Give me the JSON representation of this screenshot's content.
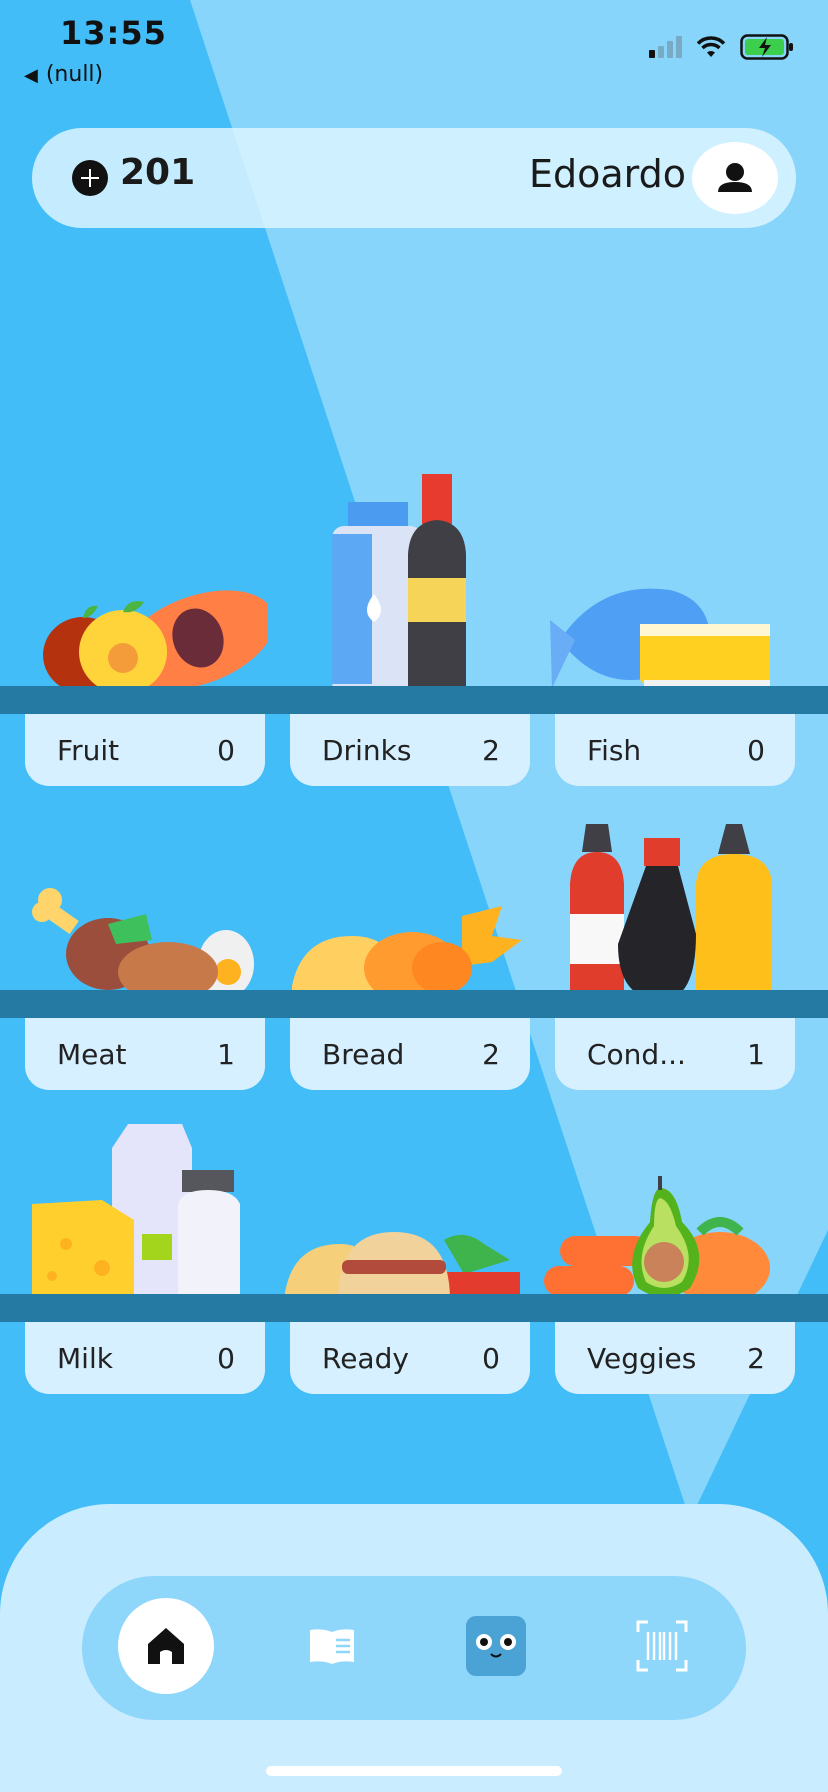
{
  "status": {
    "time": "13:55",
    "back_label": "(null)"
  },
  "header": {
    "coins": "201",
    "user_name": "Edoardo"
  },
  "categories": [
    {
      "label": "Fruit",
      "count": "0"
    },
    {
      "label": "Drinks",
      "count": "2"
    },
    {
      "label": "Fish",
      "count": "0"
    },
    {
      "label": "Meat",
      "count": "1"
    },
    {
      "label": "Bread",
      "count": "2"
    },
    {
      "label": "Cond...",
      "count": "1"
    },
    {
      "label": "Milk",
      "count": "0"
    },
    {
      "label": "Ready",
      "count": "0"
    },
    {
      "label": "Veggies",
      "count": "2"
    }
  ],
  "colors": {
    "background": "#43bdf8",
    "shelf": "#247aa3",
    "card": "#d6f0ff",
    "nav": "#8fd6fb"
  },
  "nav": {
    "items": [
      "home-icon",
      "book-icon",
      "mascot-icon",
      "barcode-scan-icon"
    ],
    "active": "home-icon"
  }
}
